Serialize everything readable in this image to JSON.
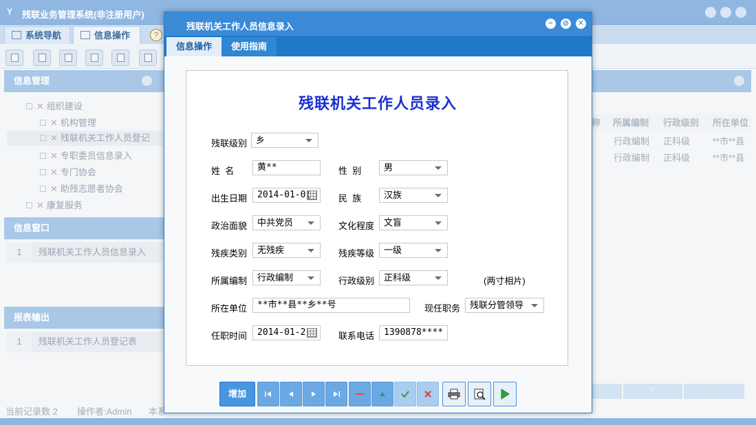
{
  "app": {
    "title": "残联业务管理系统(非注册用户)",
    "logo": "Y",
    "tabs": [
      {
        "label": "系统导航",
        "icon": "monitor-icon"
      },
      {
        "label": "信息操作",
        "icon": "grid-icon"
      }
    ],
    "help_icon": "?"
  },
  "sidebar": {
    "info_mgmt": {
      "header": "信息管理",
      "tree": [
        {
          "label": "组织建设",
          "level": 0
        },
        {
          "label": "机构管理",
          "level": 1
        },
        {
          "label": "残联机关工作人员登记",
          "level": 1
        },
        {
          "label": "专职委员信息录入",
          "level": 1
        },
        {
          "label": "专门协会",
          "level": 1
        },
        {
          "label": "助残志愿者协会",
          "level": 1
        },
        {
          "label": "康复服务",
          "level": 0
        }
      ]
    },
    "info_window": {
      "header": "信息窗口",
      "rows": [
        {
          "num": "1",
          "text": "残联机关工作人员信息录入"
        }
      ]
    },
    "report": {
      "header": "报表输出",
      "rows": [
        {
          "num": "1",
          "text": "残联机关工作人员登记表"
        }
      ]
    }
  },
  "grid": {
    "headers": [
      "所属编制",
      "行政级别",
      "所在单位"
    ],
    "partial_header": "称",
    "rows": [
      [
        "行政编制",
        "正科级",
        "**市**县"
      ],
      [
        "行政编制",
        "正科级",
        "**市**县"
      ]
    ]
  },
  "status": {
    "record_count": "当前记录数 2",
    "operator": "操作者:Admin",
    "extra": "本系"
  },
  "dialog": {
    "title": "残联机关工作人员信息录入",
    "tabs": [
      {
        "label": "信息操作",
        "active": true
      },
      {
        "label": "使用指南",
        "active": false
      }
    ],
    "form_title": "残联机关工作人员录入",
    "fields": {
      "level": {
        "label": "残联级别",
        "value": "乡"
      },
      "name": {
        "label": "姓  名",
        "value": "黄**"
      },
      "gender": {
        "label": "性  别",
        "value": "男"
      },
      "birth": {
        "label": "出生日期",
        "value": "2014-01-0("
      },
      "ethnic": {
        "label": "民  族",
        "value": "汉族"
      },
      "political": {
        "label": "政治面貌",
        "value": "中共党员"
      },
      "education": {
        "label": "文化程度",
        "value": "文盲"
      },
      "disability_type": {
        "label": "残疾类别",
        "value": "无残疾"
      },
      "disability_level": {
        "label": "残疾等级",
        "value": "一级"
      },
      "staffing": {
        "label": "所属编制",
        "value": "行政编制"
      },
      "admin_level": {
        "label": "行政级别",
        "value": "正科级"
      },
      "unit": {
        "label": "所在单位",
        "value": "**市**县**乡**号"
      },
      "position": {
        "label": "现任职务",
        "value": "残联分管领导"
      },
      "tenure": {
        "label": "任职时间",
        "value": "2014-01-2"
      },
      "phone": {
        "label": "联系电话",
        "value": "1390878****"
      }
    },
    "photo_label": "(两寸相片)",
    "buttons": {
      "add": "增加"
    }
  }
}
